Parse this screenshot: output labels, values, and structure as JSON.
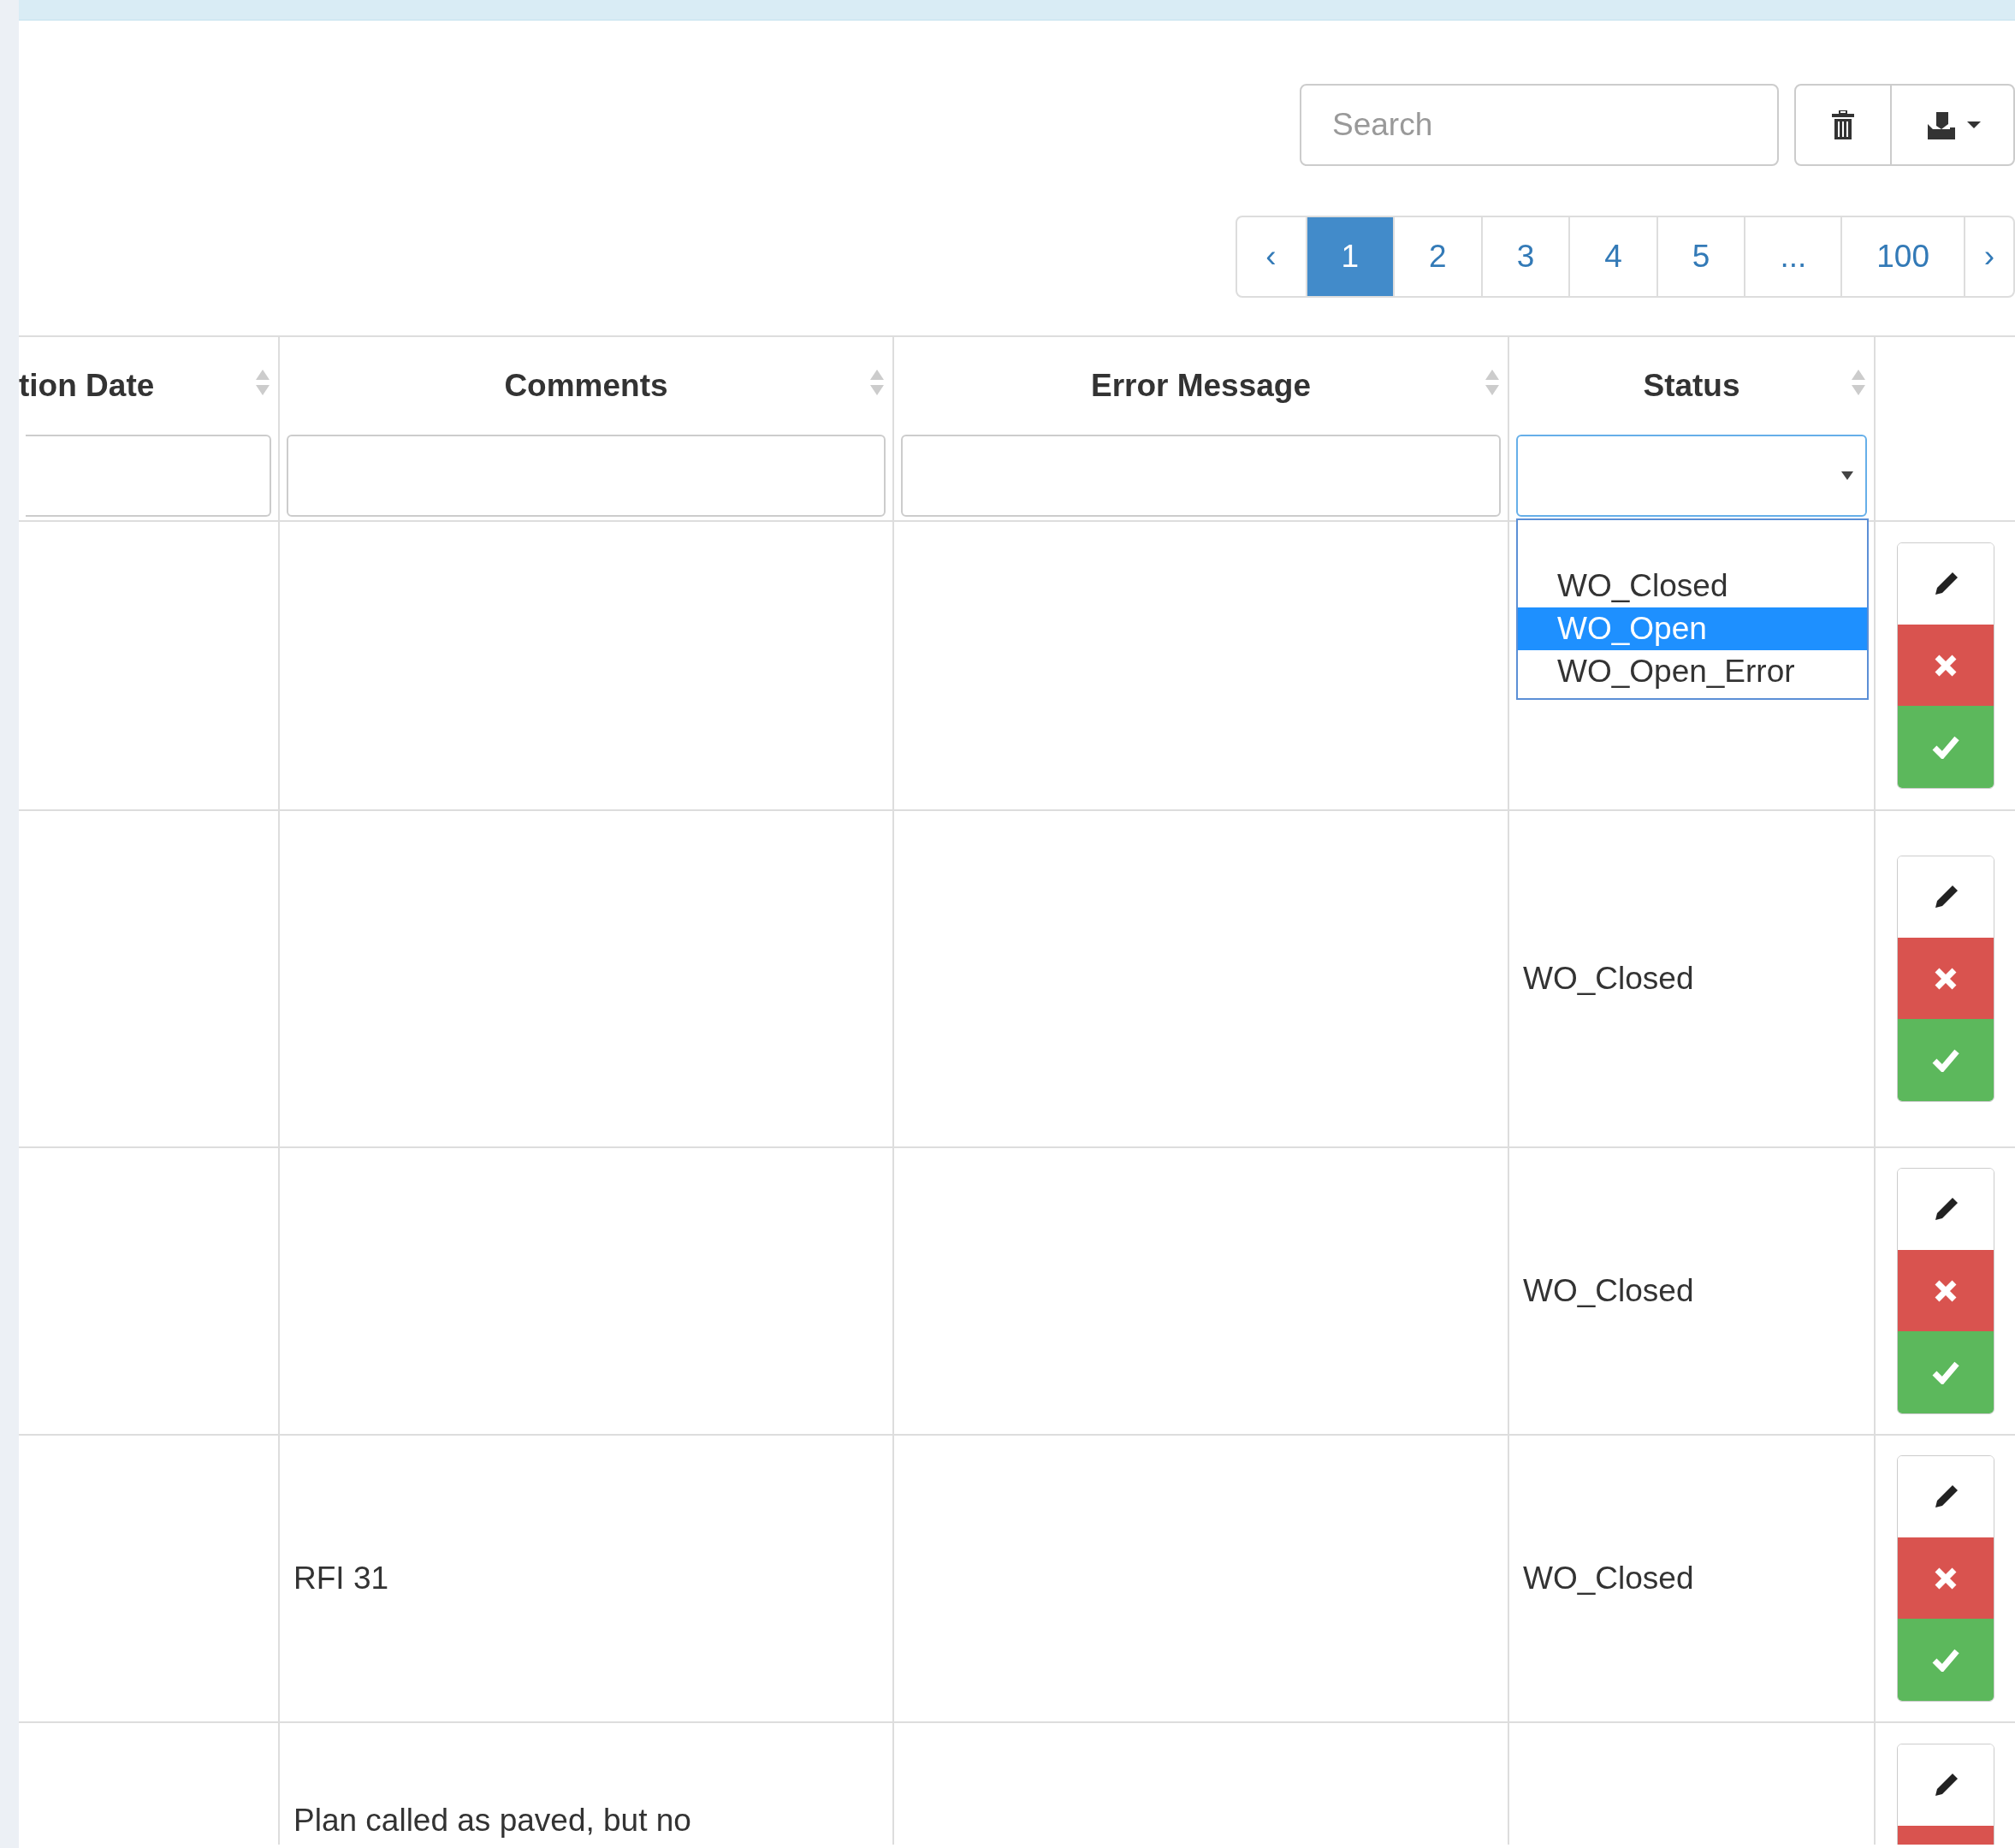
{
  "toolbar": {
    "search": {
      "placeholder": "Search"
    }
  },
  "pagination": {
    "prev": "‹",
    "next": "›",
    "pages": [
      {
        "label": "1",
        "selected": true
      },
      {
        "label": "2",
        "selected": false
      },
      {
        "label": "3",
        "selected": false
      },
      {
        "label": "4",
        "selected": false
      },
      {
        "label": "5",
        "selected": false
      },
      {
        "label": "...",
        "selected": false
      },
      {
        "label": "100",
        "selected": false
      }
    ]
  },
  "table": {
    "columns": [
      {
        "label": "tion Date",
        "sortable": true,
        "kind": "text"
      },
      {
        "label": "Comments",
        "sortable": true,
        "kind": "text"
      },
      {
        "label": "Error Message",
        "sortable": true,
        "kind": "text"
      },
      {
        "label": "Status",
        "sortable": true,
        "kind": "select"
      }
    ],
    "status_filter": {
      "expanded": true,
      "options": [
        {
          "label": "WO_Closed",
          "selected": false
        },
        {
          "label": "WO_Open",
          "selected": true
        },
        {
          "label": "WO_Open_Error",
          "selected": false
        }
      ]
    },
    "rows": [
      {},
      {
        "status": "WO_Closed"
      },
      {
        "status": "WO_Closed"
      },
      {
        "comments": "RFI 31",
        "status": "WO_Closed"
      },
      {
        "comments": "Plan called as paved, but no"
      }
    ]
  }
}
